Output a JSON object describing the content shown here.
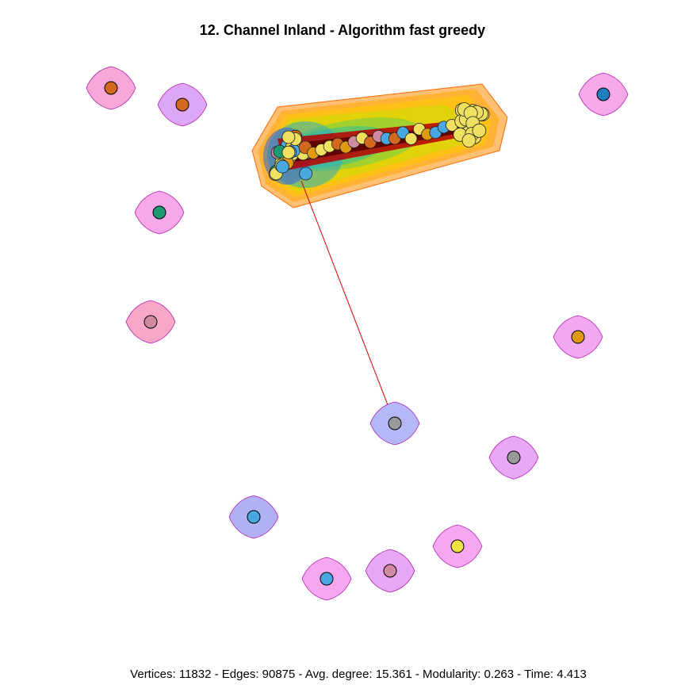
{
  "title": "12. Channel Inland - Algorithm fast greedy",
  "stats": {
    "text": "Vertices: 11832 - Edges: 90875 - Avg. degree: 15.361 - Modularity: 0.263 - Time: 4.413",
    "vertices": 11832,
    "edges": 90875,
    "avg_degree": 15.361,
    "modularity": 0.263,
    "time": 4.413
  },
  "colors": {
    "edge": "#d40000",
    "node_outline": "#000000",
    "main_hull_gradient": [
      "#ff7a00",
      "#ff9a10",
      "#ffc800",
      "#d4e000",
      "#7ccf3a",
      "#2fbf8a",
      "#20a0c8",
      "#3060e0"
    ]
  },
  "isolated_clusters": [
    {
      "id": "c1",
      "hull_color": "#f7a8d8",
      "node_color": "#d2691e"
    },
    {
      "id": "c2",
      "hull_color": "#dca8f5",
      "node_color": "#d2691e"
    },
    {
      "id": "c3",
      "hull_color": "#f7a8e8",
      "node_color": "#1e7fbf"
    },
    {
      "id": "c4",
      "hull_color": "#f7a8e8",
      "node_color": "#1a9a70"
    },
    {
      "id": "c5",
      "hull_color": "#f7a8c8",
      "node_color": "#d08aa0"
    },
    {
      "id": "c6",
      "hull_color": "#f2a8f0",
      "node_color": "#e09a10"
    },
    {
      "id": "c7",
      "hull_color": "#b4b8f7",
      "node_color": "#9a9a9a"
    },
    {
      "id": "c8",
      "hull_color": "#e8a8f5",
      "node_color": "#9a9a9a"
    },
    {
      "id": "c9",
      "hull_color": "#b0b0f5",
      "node_color": "#4aa8e0"
    },
    {
      "id": "c10",
      "hull_color": "#f5a8f0",
      "node_color": "#f0e040"
    },
    {
      "id": "c11",
      "hull_color": "#f5a8f0",
      "node_color": "#4aa8e0"
    },
    {
      "id": "c12",
      "hull_color": "#e8a8f5",
      "node_color": "#d08aa0"
    }
  ]
}
